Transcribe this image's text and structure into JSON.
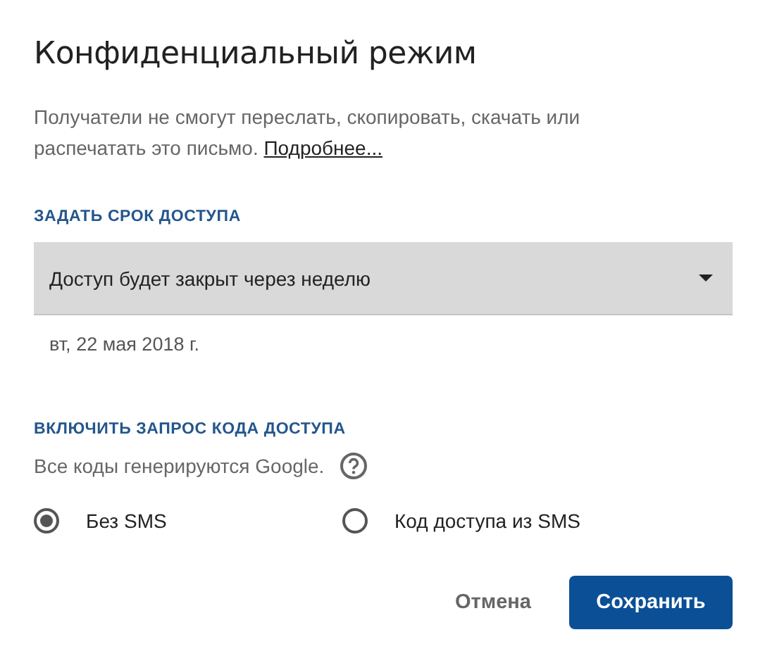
{
  "dialog": {
    "title": "Конфиденциальный режим",
    "description": "Получатели не смогут переслать, скопировать, скачать или распечатать это письмо.",
    "learn_more_link": "Подробнее..."
  },
  "expiry": {
    "heading": "ЗАДАТЬ СРОК ДОСТУПА",
    "dropdown_value": "Доступ будет закрыт через неделю",
    "date": "вт, 22 мая 2018 г."
  },
  "passcode": {
    "heading": "ВКЛЮЧИТЬ ЗАПРОС КОДА ДОСТУПА",
    "hint": "Все коды генерируются Google.",
    "options": [
      {
        "label": "Без SMS",
        "selected": true
      },
      {
        "label": "Код доступа из SMS",
        "selected": false
      }
    ]
  },
  "buttons": [
    {
      "label": "Отмена",
      "kind": "text"
    },
    {
      "label": "Сохранить",
      "kind": "primary"
    }
  ]
}
